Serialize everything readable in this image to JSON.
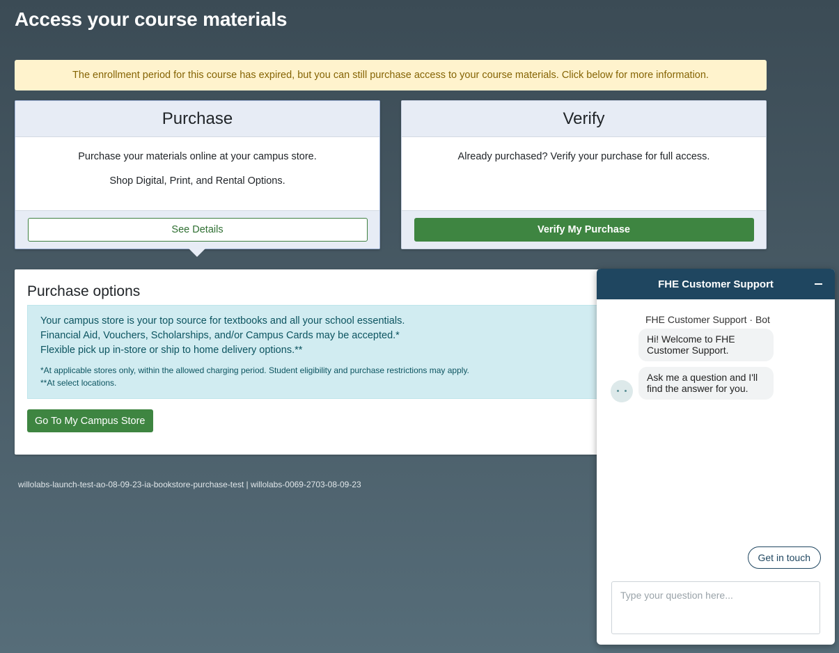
{
  "page": {
    "title": "Access your course materials",
    "alert": "The enrollment period for this course has expired, but you can still purchase access to your course materials. Click below for more information."
  },
  "purchase_card": {
    "title": "Purchase",
    "line1": "Purchase your materials online at your campus store.",
    "line2": "Shop Digital, Print, and Rental Options.",
    "button": "See Details"
  },
  "verify_card": {
    "title": "Verify",
    "line1": "Already purchased? Verify your purchase for full access.",
    "button": "Verify My Purchase"
  },
  "purchase_options": {
    "title": "Purchase options",
    "lines": [
      "Your campus store is your top source for textbooks and all your school essentials.",
      "Financial Aid, Vouchers, Scholarships, and/or Campus Cards may be accepted.*",
      "Flexible pick up in-store or ship to home delivery options.**"
    ],
    "notes": [
      "*At applicable stores only, within the allowed charging period. Student eligibility and purchase restrictions may apply.",
      "**At select locations."
    ],
    "button": "Go To My Campus Store"
  },
  "footer": {
    "identifier": "willolabs-launch-test-ao-08-09-23-ia-bookstore-purchase-test | willolabs-0069-2703-08-09-23"
  },
  "chat": {
    "title": "FHE Customer Support",
    "bot_label": "FHE Customer Support  ·  Bot",
    "messages": [
      "Hi! Welcome to FHE Customer Support.",
      "Ask me a question and I'll find the answer for you."
    ],
    "get_in_touch": "Get in touch",
    "input_placeholder": "Type your question here...",
    "input_value": ""
  },
  "colors": {
    "brand_green": "#3e8541",
    "chat_header": "#1f4660",
    "alert_bg": "#fff3cd",
    "info_bg": "#d1ecf1"
  },
  "icons": [
    "minimize-icon",
    "bot-avatar-icon",
    "caret-down-icon"
  ]
}
